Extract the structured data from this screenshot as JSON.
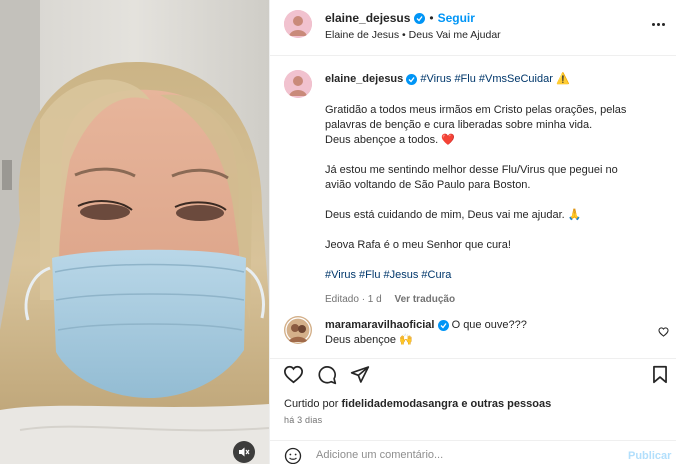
{
  "post": {
    "username": "elaine_dejesus",
    "separator": "•",
    "follow_label": "Seguir",
    "subtitle": "Elaine de Jesus • Deus Vai me Ajudar",
    "more_icon": "more-horizontal-icon"
  },
  "caption": {
    "username": "elaine_dejesus",
    "title_tags": "#Virus #Flu #VmsSeCuidar",
    "title_emoji": "⚠️",
    "para1_line1": "Gratidão a todos meus irmãos em Cristo pelas orações, pelas",
    "para1_line2": "palavras de benção e cura liberadas sobre minha vida.",
    "para1_line3": "Deus abençoe a todos.",
    "para1_emoji": "❤️",
    "para2_line1": "Já estou me sentindo melhor desse Flu/Virus que peguei no",
    "para2_line2": "avião voltando de São Paulo para Boston.",
    "para3": "Deus está cuidando de mim, Deus vai me ajudar.",
    "para3_emoji": "🙏",
    "para4": "Jeova Rafa é o meu Senhor que cura!",
    "bottom_tags": "#Virus #Flu #Jesus #Cura",
    "edited_label": "Editado · 1 d",
    "translate_label": "Ver tradução"
  },
  "comment": {
    "username": "maramaravilhaoficial",
    "text_line1": "O que ouve???",
    "text_line2": "Deus abençoe",
    "text_emoji": "🙌"
  },
  "actions": {
    "like_icon": "heart-icon",
    "comment_icon": "comment-icon",
    "share_icon": "send-icon",
    "save_icon": "bookmark-icon"
  },
  "likes": {
    "prefix": "Curtido por",
    "user": "fidelidademodasangra",
    "suffix": "e outras pessoas"
  },
  "time_label": "há 3 dias",
  "add_comment": {
    "placeholder": "Adicione um comentário...",
    "publish_label": "Publicar"
  },
  "colors": {
    "accent": "#0095f6",
    "hashtag": "#00376b",
    "secondary_text": "#737373",
    "mask": "#a9cce0"
  }
}
